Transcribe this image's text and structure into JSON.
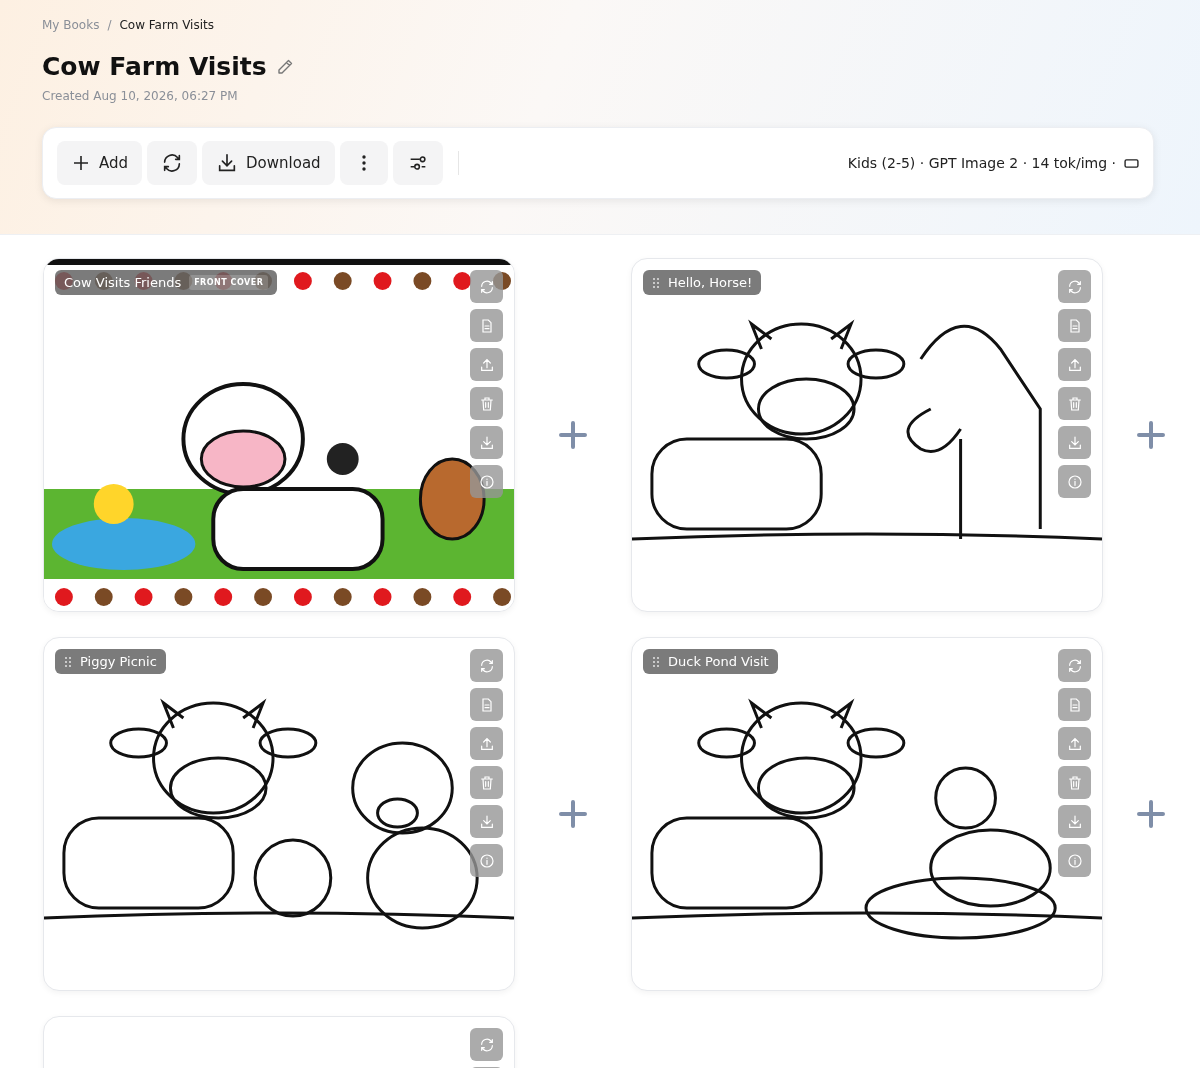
{
  "breadcrumb": [
    {
      "label": "My Books",
      "current": false
    },
    {
      "label": "Cow Farm Visits",
      "current": true
    }
  ],
  "breadcrumb_separator": "/",
  "title": "Cow Farm Visits",
  "created": "Created Aug 10, 2026, 06:27 PM",
  "toolbar": {
    "buttons": [
      {
        "kind": "add",
        "label": "Add"
      },
      {
        "kind": "refresh"
      },
      {
        "kind": "download",
        "label": "Download"
      },
      {
        "kind": "more"
      },
      {
        "kind": "settings"
      }
    ],
    "info": "Kids (2-5) · GPT Image 2 · 14 tok/img ·"
  },
  "pages": [
    {
      "kind": "cover",
      "title": "Cow Visits Friends",
      "badge": "FRONT COVER"
    },
    {
      "kind": "horse",
      "title": "Hello, Horse!"
    },
    {
      "kind": "pig",
      "title": "Piggy Picnic"
    },
    {
      "kind": "duck",
      "title": "Duck Pond Visit"
    },
    {
      "kind": "blank"
    }
  ]
}
